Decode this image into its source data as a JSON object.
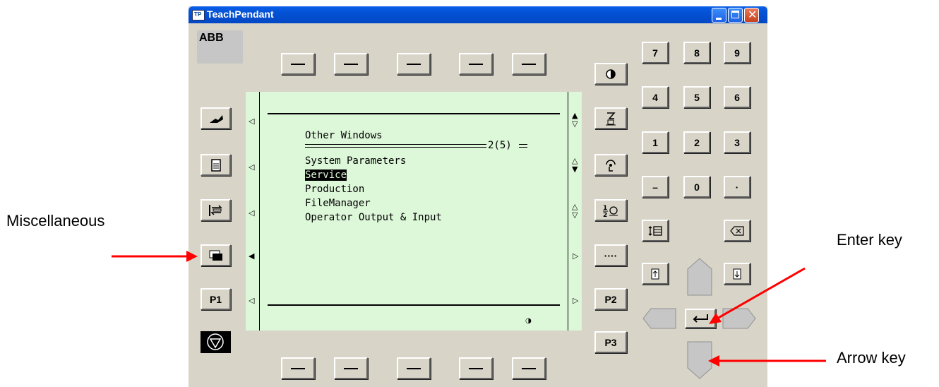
{
  "window": {
    "title": "TeachPendant",
    "logo": "ABB",
    "app_icon_text": "TP"
  },
  "function_keys_top": [
    "—",
    "—",
    "—",
    "—",
    "—"
  ],
  "function_keys_bottom": [
    "—",
    "—",
    "—",
    "—",
    "—"
  ],
  "left_keys": {
    "p1": "P1"
  },
  "right_keys": {
    "dots": "····",
    "p2": "P2",
    "p3": "P3"
  },
  "keypad": {
    "row1": [
      "7",
      "8",
      "9"
    ],
    "row2": [
      "4",
      "5",
      "6"
    ],
    "row3": [
      "1",
      "2",
      "3"
    ],
    "row4": [
      "–",
      "0",
      "·"
    ]
  },
  "screen": {
    "heading": "Other Windows",
    "page_indicator": "2(5)",
    "items": [
      "System Parameters",
      "Service",
      "Production",
      "FileManager",
      "Operator Output & Input"
    ],
    "selected_index": 1
  },
  "annotations": {
    "miscellaneous": "Miscellaneous",
    "enter_key": "Enter key",
    "arrow_key": "Arrow key"
  },
  "colors": {
    "lcd": "#ddf7d9",
    "title_bar": "#0351d4",
    "panel": "#d8d5c8",
    "arrow": "#ff0000"
  },
  "icons": {
    "misc_button": "windows-stack-icon",
    "stop": "stop-icon",
    "enter": "enter-arrow-icon",
    "backspace": "backspace-icon"
  }
}
